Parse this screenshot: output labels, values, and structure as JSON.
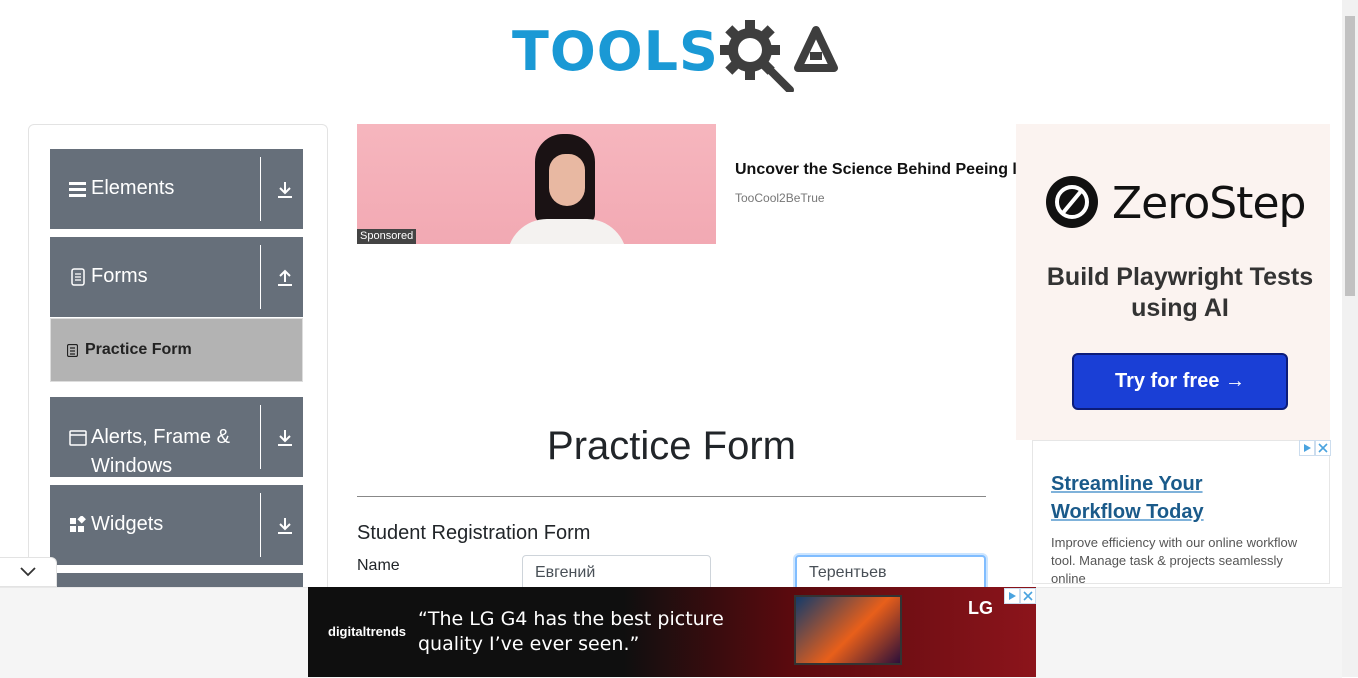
{
  "header": {
    "logo_text": "TOOLS",
    "logo_text_2": "QA"
  },
  "sidebar": {
    "groups": [
      {
        "label": "Elements",
        "icon": "hamburger-icon",
        "arrow": "download-icon"
      },
      {
        "label": "Forms",
        "icon": "form-icon",
        "arrow": "upload-icon"
      },
      {
        "label": "Alerts, Frame & Windows",
        "icon": "window-icon",
        "arrow": "download-icon"
      },
      {
        "label": "Widgets",
        "icon": "widgets-icon",
        "arrow": "download-icon"
      }
    ],
    "active_item": "Practice Form"
  },
  "top_ad": {
    "badge": "Sponsored",
    "title": "Uncover the Science Behind Peeing l",
    "source": "TooCool2BeTrue"
  },
  "main": {
    "page_title": "Practice Form",
    "form_title": "Student Registration Form",
    "name_label": "Name",
    "first_name_value": "Евгений",
    "last_name_value": "Терентьев"
  },
  "right_ad": {
    "brand": "ZeroStep",
    "tagline": "Build Playwright Tests using AI",
    "button": "Try for free →",
    "ad2_title": "Streamline Your Workflow Today",
    "ad2_text": "Improve efficiency with our online workflow tool. Manage task & projects seamlessly online"
  },
  "bottom_ad": {
    "source_logo": "digitaltrends",
    "quote": "“The LG G4 has the best picture quality I’ve ever seen.”",
    "brand": "LG"
  },
  "colors": {
    "brand_blue": "#1a99d5",
    "sidebar_group": "#666f7a",
    "sidebar_active": "#b3b3b3",
    "cta_blue": "#1a3fd6"
  }
}
